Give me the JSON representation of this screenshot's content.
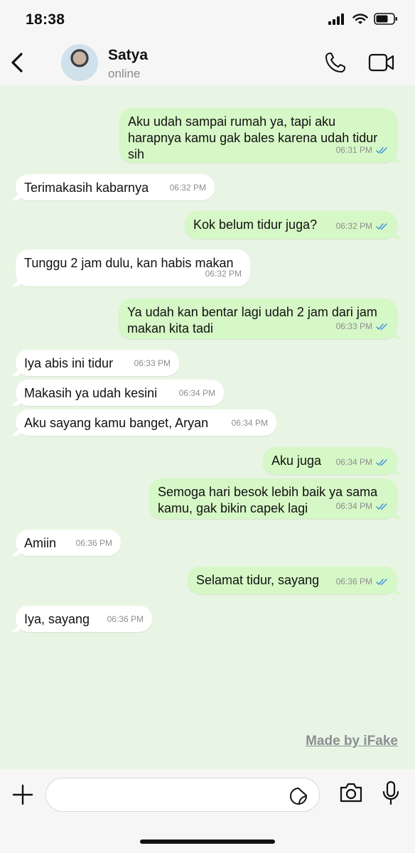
{
  "status_bar": {
    "time": "18:38"
  },
  "header": {
    "contact_name": "Satya",
    "contact_status": "online"
  },
  "messages": [
    {
      "dir": "out",
      "text": "Aku udah sampai rumah ya, tapi aku harapnya kamu gak bales karena udah tidur sih",
      "time": "06:31 PM",
      "read": true
    },
    {
      "dir": "in",
      "text": "Terimakasih kabarnya",
      "time": "06:32 PM"
    },
    {
      "dir": "out",
      "text": "Kok belum tidur juga?",
      "time": "06:32 PM",
      "read": true
    },
    {
      "dir": "in",
      "text": "Tunggu 2 jam dulu, kan habis makan",
      "time": "06:32 PM"
    },
    {
      "dir": "out",
      "text": "Ya udah kan bentar lagi udah 2 jam dari jam makan kita tadi",
      "time": "06:33 PM",
      "read": true
    },
    {
      "dir": "in",
      "text": "Iya abis ini tidur",
      "time": "06:33 PM"
    },
    {
      "dir": "in",
      "text": "Makasih ya udah kesini",
      "time": "06:34 PM"
    },
    {
      "dir": "in",
      "text": "Aku sayang kamu banget, Aryan",
      "time": "06:34 PM"
    },
    {
      "dir": "out",
      "text": "Aku juga",
      "time": "06:34 PM",
      "read": true
    },
    {
      "dir": "out",
      "text": "Semoga hari besok lebih baik ya sama kamu, gak bikin capek lagi",
      "time": "06:34 PM",
      "read": true
    },
    {
      "dir": "in",
      "text": "Amiin",
      "time": "06:36 PM"
    },
    {
      "dir": "out",
      "text": "Selamat tidur, sayang",
      "time": "06:36 PM",
      "read": true
    },
    {
      "dir": "in",
      "text": "Iya, sayang",
      "time": "06:36 PM"
    }
  ],
  "watermark": "Made by iFake",
  "input": {
    "placeholder": ""
  },
  "colors": {
    "chat_bg": "#e8f5e4",
    "outgoing_bubble": "#d6f7c6",
    "incoming_bubble": "#ffffff",
    "read_tick": "#3b8fe0"
  },
  "icons": [
    "back-chevron-icon",
    "phone-icon",
    "video-camera-icon",
    "plus-icon",
    "sticker-icon",
    "camera-icon",
    "microphone-icon",
    "double-check-icon",
    "signal-icon",
    "wifi-icon",
    "battery-icon"
  ]
}
